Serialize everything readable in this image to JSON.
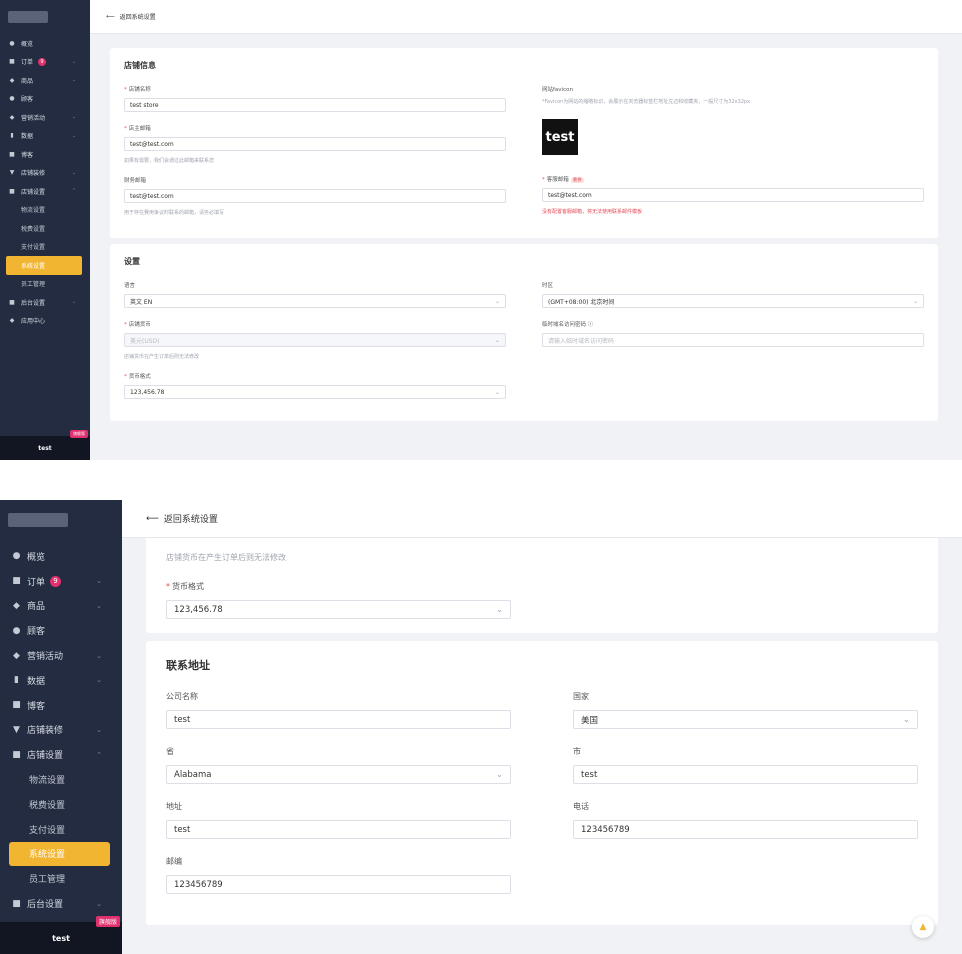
{
  "shot1": {
    "topbar": {
      "back_label": "返回系统设置"
    },
    "sidebar": {
      "items": [
        {
          "label": "概览",
          "icon": "●"
        },
        {
          "label": "订单",
          "icon": "■",
          "badge": "9",
          "chev": "⌄"
        },
        {
          "label": "商品",
          "icon": "◆",
          "chev": "⌄"
        },
        {
          "label": "顾客",
          "icon": "●"
        },
        {
          "label": "营销活动",
          "icon": "◆",
          "chev": "⌄"
        },
        {
          "label": "数据",
          "icon": "▮",
          "chev": "⌄"
        },
        {
          "label": "博客",
          "icon": "■"
        },
        {
          "label": "店铺装修",
          "icon": "▼",
          "chev": "⌄"
        },
        {
          "label": "店铺设置",
          "icon": "■",
          "chev": "⌃"
        },
        {
          "label": "物流设置"
        },
        {
          "label": "税费设置"
        },
        {
          "label": "支付设置"
        },
        {
          "label": "系统设置"
        },
        {
          "label": "员工管理"
        },
        {
          "label": "后台设置",
          "icon": "■",
          "chev": "⌄"
        },
        {
          "label": "应用中心",
          "icon": "◆"
        }
      ],
      "store_name": "test",
      "edition": "旗舰版"
    },
    "store_info": {
      "title": "店铺信息",
      "store_name_label": "店铺名称",
      "store_name_value": "test store",
      "owner_email_label": "店主邮箱",
      "owner_email_value": "test@test.com",
      "owner_email_help": "如果有需要，我们会通过此邮箱来联系您",
      "finance_email_label": "财务邮箱",
      "finance_email_value": "test@test.com",
      "finance_email_help": "用于存在費用争议时联系的邮箱，请务必填写",
      "favicon_label": "网站favicon",
      "favicon_help": "*Favicon为网站的缩略标识，会展示在浏览器标签栏地址左边和收藏夹，一般尺寸为32x32px",
      "favicon_text": "test",
      "service_email_label": "客服邮箱",
      "service_email_tag": "重要",
      "service_email_value": "test@test.com",
      "service_email_warn": "没有配置客服邮箱，将无法使用联系邮件模板"
    },
    "settings": {
      "title": "设置",
      "language_label": "语言",
      "language_value": "英文 EN",
      "timezone_label": "时区",
      "timezone_value": "(GMT+08:00) 北京时间",
      "currency_label": "店铺货币",
      "currency_value": "美元(USD)",
      "temp_password_label": "临时域名访问密码",
      "temp_password_placeholder": "请输入临时域名访问密码",
      "currency_help": "店铺货币在产生订单后则无法修改",
      "format_label": "货币格式",
      "format_value": "123,456.78"
    }
  },
  "shot2": {
    "topbar": {
      "back_label": "返回系统设置"
    },
    "sidebar": {
      "items": [
        {
          "label": "概览",
          "icon": "●"
        },
        {
          "label": "订单",
          "icon": "■",
          "badge": "9",
          "chev": "⌄"
        },
        {
          "label": "商品",
          "icon": "◆",
          "chev": "⌄"
        },
        {
          "label": "顾客",
          "icon": "●"
        },
        {
          "label": "营销活动",
          "icon": "◆",
          "chev": "⌄"
        },
        {
          "label": "数据",
          "icon": "▮",
          "chev": "⌄"
        },
        {
          "label": "博客",
          "icon": "■"
        },
        {
          "label": "店铺装修",
          "icon": "▼",
          "chev": "⌄"
        },
        {
          "label": "店铺设置",
          "icon": "■",
          "chev": "⌃"
        },
        {
          "label": "物流设置"
        },
        {
          "label": "税费设置"
        },
        {
          "label": "支付设置"
        },
        {
          "label": "系统设置"
        },
        {
          "label": "员工管理"
        },
        {
          "label": "后台设置",
          "icon": "■",
          "chev": "⌄"
        }
      ],
      "store_name": "test",
      "edition": "旗舰版"
    },
    "settings_tail": {
      "currency_help": "店铺货币在产生订单后则无法修改",
      "format_label": "货币格式",
      "format_value": "123,456.78"
    },
    "address": {
      "title": "联系地址",
      "company_label": "公司名称",
      "company_value": "test",
      "country_label": "国家",
      "country_value": "美国",
      "province_label": "省",
      "province_value": "Alabama",
      "city_label": "市",
      "city_value": "test",
      "address_label": "地址",
      "address_value": "test",
      "phone_label": "电话",
      "phone_value": "123456789",
      "zip_label": "邮编",
      "zip_value": "123456789"
    }
  },
  "colors": {
    "sidebar_bg": "#232c40",
    "accent": "#f2b531",
    "badge": "#e0316e",
    "required": "#e34d59"
  }
}
